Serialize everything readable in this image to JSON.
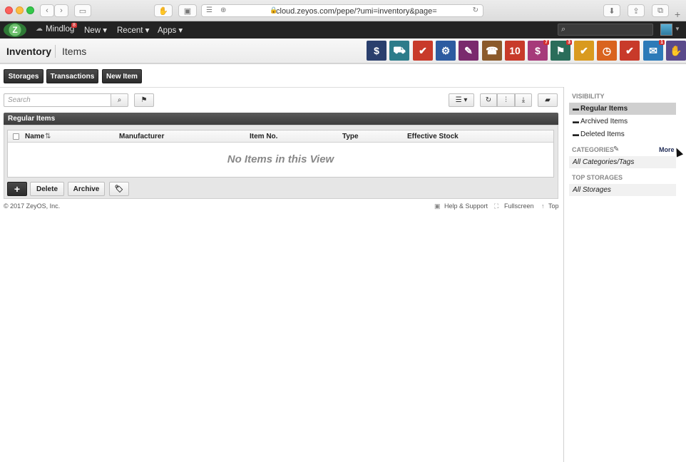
{
  "browser": {
    "url": "cloud.zeyos.com/pepe/?umi=inventory&page="
  },
  "topnav": {
    "logo_text": "Z",
    "items": [
      "Mindlog",
      "New ▾",
      "Recent ▾",
      "Apps ▾"
    ],
    "mindlog_badge": "8"
  },
  "header": {
    "title": "Inventory",
    "subtitle": "Items",
    "app_icons": [
      {
        "name": "dollar-icon",
        "color": "#2a3f6d",
        "glyph": "$"
      },
      {
        "name": "truck-icon",
        "color": "#2d7c8a",
        "glyph": "⛟"
      },
      {
        "name": "folder-check-icon",
        "color": "#c83a2a",
        "glyph": "✔"
      },
      {
        "name": "gear-icon",
        "color": "#2d5ba0",
        "glyph": "⚙"
      },
      {
        "name": "document-user-icon",
        "color": "#7a2a6d",
        "glyph": "✎"
      },
      {
        "name": "contacts-icon",
        "color": "#8b5a2b",
        "glyph": "☎"
      },
      {
        "name": "calendar-icon",
        "color": "#c83a2a",
        "glyph": "10"
      },
      {
        "name": "cashier-icon",
        "color": "#a63a7a",
        "glyph": "$",
        "badge": "7"
      },
      {
        "name": "flag-icon",
        "color": "#2a6d5a",
        "glyph": "⚑",
        "badge": "3"
      },
      {
        "name": "tasks-icon",
        "color": "#d99a1f",
        "glyph": "✔"
      },
      {
        "name": "timer-icon",
        "color": "#d9641f",
        "glyph": "◷"
      },
      {
        "name": "invoice-icon",
        "color": "#c83a2a",
        "glyph": "✔"
      },
      {
        "name": "mail-icon",
        "color": "#2d7ab8",
        "glyph": "✉",
        "badge": "1"
      },
      {
        "name": "handshake-icon",
        "color": "#5a4a8b",
        "glyph": "✋"
      }
    ]
  },
  "toolbar": {
    "storages": "Storages",
    "transactions": "Transactions",
    "new_item": "New Item"
  },
  "search": {
    "placeholder": "Search"
  },
  "table": {
    "title": "Regular Items",
    "columns": [
      "Name",
      "Manufacturer",
      "Item No.",
      "Type",
      "Effective Stock"
    ],
    "empty_message": "No Items in this View"
  },
  "actions": {
    "add": "+",
    "delete": "Delete",
    "archive": "Archive"
  },
  "footer": {
    "copyright": "© 2017 ZeyOS, Inc.",
    "help": "Help & Support",
    "fullscreen": "Fullscreen",
    "top": "Top"
  },
  "sidebar": {
    "visibility_heading": "VISIBILITY",
    "visibility_items": [
      "Regular Items",
      "Archived Items",
      "Deleted Items"
    ],
    "categories_heading": "CATEGORIES",
    "categories_more": "More",
    "categories_item": "All Categories/Tags",
    "storages_heading": "TOP STORAGES",
    "storages_item": "All Storages"
  }
}
